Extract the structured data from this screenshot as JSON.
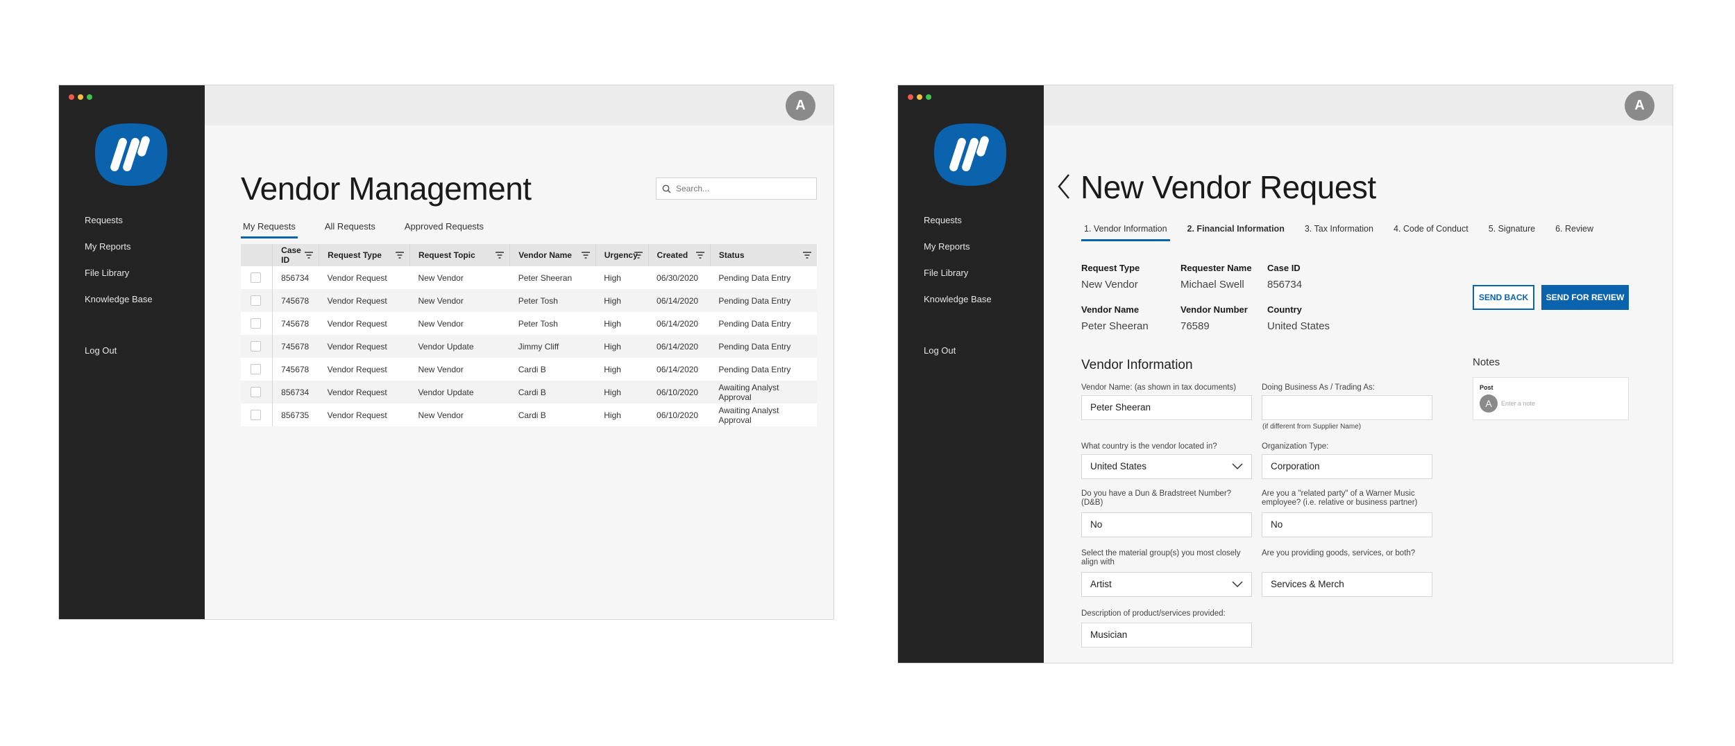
{
  "window_dots": [
    "#f05a4f",
    "#f5bf3f",
    "#3fc54f"
  ],
  "brand_color": "#0b63ad",
  "avatar_initial": "A",
  "sidebar": {
    "items": [
      "Requests",
      "My Reports",
      "File Library",
      "Knowledge Base"
    ],
    "logout": "Log Out"
  },
  "vendor_management": {
    "title": "Vendor Management",
    "search_placeholder": "Search...",
    "tabs": [
      "My Requests",
      "All Requests",
      "Approved Requests"
    ],
    "active_tab": "My Requests",
    "columns": [
      "Case ID",
      "Request Type",
      "Request Topic",
      "Vendor Name",
      "Urgency",
      "Created",
      "Status"
    ],
    "rows": [
      [
        "856734",
        "Vendor Request",
        "New Vendor",
        "Peter Sheeran",
        "High",
        "06/30/2020",
        "Pending Data Entry"
      ],
      [
        "745678",
        "Vendor Request",
        "New Vendor",
        "Peter Tosh",
        "High",
        "06/14/2020",
        "Pending Data Entry"
      ],
      [
        "745678",
        "Vendor Request",
        "New Vendor",
        "Peter Tosh",
        "High",
        "06/14/2020",
        "Pending Data Entry"
      ],
      [
        "745678",
        "Vendor Request",
        "Vendor Update",
        "Jimmy Cliff",
        "High",
        "06/14/2020",
        "Pending Data Entry"
      ],
      [
        "745678",
        "Vendor Request",
        "New Vendor",
        "Cardi B",
        "High",
        "06/14/2020",
        "Pending Data Entry"
      ],
      [
        "856734",
        "Vendor Request",
        "Vendor Update",
        "Cardi B",
        "High",
        "06/10/2020",
        "Awaiting Analyst Approval"
      ],
      [
        "856735",
        "Vendor Request",
        "New Vendor",
        "Cardi B",
        "High",
        "06/10/2020",
        "Awaiting Analyst Approval"
      ]
    ]
  },
  "new_vendor": {
    "title": "New Vendor Request",
    "steps": [
      "1. Vendor Information",
      "2. Financial Information",
      "3. Tax Information",
      "4. Code of Conduct",
      "5. Signature",
      "6. Review"
    ],
    "summary": {
      "request_type_label": "Request Type",
      "request_type": "New Vendor",
      "requester_label": "Requester Name",
      "requester": "Michael Swell",
      "case_id_label": "Case ID",
      "case_id": "856734",
      "vendor_name_label": "Vendor Name",
      "vendor_name": "Peter Sheeran",
      "vendor_number_label": "Vendor Number",
      "vendor_number": "76589",
      "country_label": "Country",
      "country": "United States"
    },
    "send_back": "SEND BACK",
    "send_review": "SEND FOR REVIEW",
    "section_title": "Vendor Information",
    "form": {
      "vendor_name_label": "Vendor Name: (as shown in tax documents)",
      "vendor_name_value": "Peter Sheeran",
      "dba_label": "Doing Business As / Trading As:",
      "dba_value": "",
      "dba_hint": "(if different from Supplier Name)",
      "country_label": "What country is the vendor located in?",
      "country_value": "United States",
      "org_type_label": "Organization Type:",
      "org_type_value": "Corporation",
      "dnb_label": "Do you have a Dun & Bradstreet Number? (D&B)",
      "dnb_value": "No",
      "related_label": "Are you a \"related party\" of a Warner Music employee? (i.e. relative or business partner)",
      "related_value": "No",
      "material_label": "Select the material group(s) you most closely align with",
      "material_value": "Artist",
      "goods_label": "Are you providing goods, services, or both?",
      "goods_value": "Services & Merch",
      "description_label": "Description of product/services provided:",
      "description_value": "Musician"
    },
    "notes": {
      "title": "Notes",
      "post_label": "Post",
      "placeholder": "Enter a note"
    }
  }
}
